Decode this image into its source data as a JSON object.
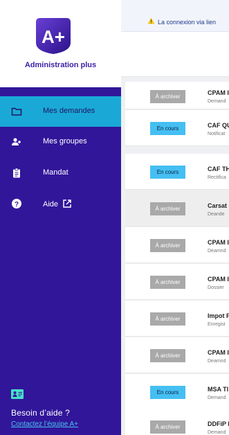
{
  "logo": {
    "mark": "A+",
    "text": "Administration plus"
  },
  "nav": [
    {
      "label": "Mes demandes",
      "icon": "folder-icon",
      "active": true
    },
    {
      "label": "Mes groupes",
      "icon": "group-add-icon",
      "active": false
    },
    {
      "label": "Mandat",
      "icon": "clipboard-icon",
      "active": false
    },
    {
      "label": "Aide",
      "icon": "help-icon",
      "active": false,
      "external": true
    }
  ],
  "help": {
    "title": "Besoin d’aide ?",
    "link": "Contactez l’équipe A+",
    "icon": "contact-card-icon"
  },
  "alert": {
    "icon": "warning-icon",
    "text": "La connexion via lien"
  },
  "colors": {
    "sidebar": "#31169a",
    "active_nav": "#1aa9d6",
    "badge_archive": "#a9a9a9",
    "badge_progress": "#45bff2",
    "link": "#46c6ee"
  },
  "rows": [
    {
      "status": "À archiver",
      "title": "CPAM I",
      "subtitle": "Demand"
    },
    {
      "status": "En cours",
      "title": "CAF QU",
      "subtitle": "Notificat"
    },
    {
      "status": "En cours",
      "title": "CAF TH",
      "subtitle": "Rectifica"
    },
    {
      "status": "À archiver",
      "title": "Carsat",
      "subtitle": "Deande",
      "selected": true
    },
    {
      "status": "À archiver",
      "title": "CPAM I",
      "subtitle": "Deamnd"
    },
    {
      "status": "À archiver",
      "title": "CPAM I",
      "subtitle": "Dossier"
    },
    {
      "status": "À archiver",
      "title": "Impot F",
      "subtitle": "Enregist"
    },
    {
      "status": "À archiver",
      "title": "CPAM I",
      "subtitle": "Deamnd"
    },
    {
      "status": "En cours",
      "title": "MSA TI",
      "subtitle": "Demand"
    },
    {
      "status": "À archiver",
      "title": "DDFiP I",
      "subtitle": "Demand"
    }
  ]
}
